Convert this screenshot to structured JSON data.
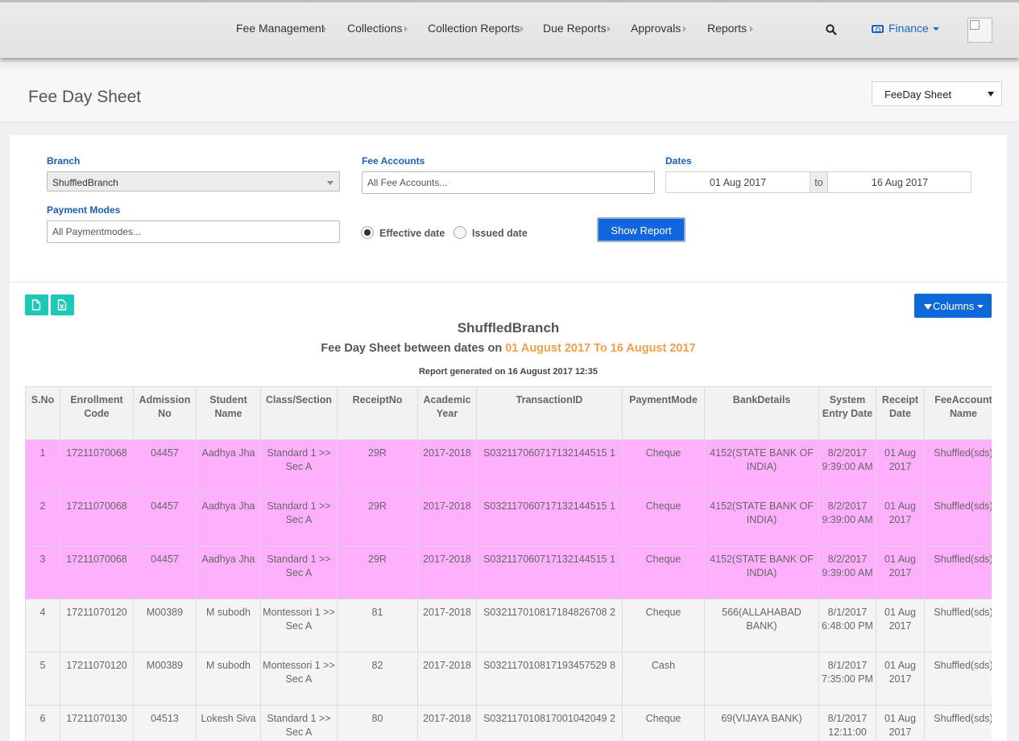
{
  "nav": {
    "items": [
      "Fee Management",
      "Collections",
      "Collection Reports",
      "Due Reports",
      "Approvals",
      "Reports"
    ],
    "finance_label": "Finance"
  },
  "page": {
    "title": "Fee Day Sheet",
    "select_value": "FeeDay Sheet"
  },
  "filters": {
    "branch_label": "Branch",
    "branch_value": "ShuffledBranch",
    "fee_accounts_label": "Fee Accounts",
    "fee_accounts_placeholder": "All Fee Accounts...",
    "dates_label": "Dates",
    "date_from": "01 Aug 2017",
    "date_sep": "to",
    "date_to": "16 Aug 2017",
    "payment_modes_label": "Payment Modes",
    "payment_modes_placeholder": "All Paymentmodes...",
    "radio_effective": "Effective date",
    "radio_issued": "Issued date",
    "show_report": "Show Report"
  },
  "toolbar": {
    "columns_label": "Columns"
  },
  "report": {
    "branch_title": "ShuffledBranch",
    "subtitle_prefix": "Fee Day Sheet between dates on",
    "subtitle_range": "01 August 2017 To 16 August 2017",
    "generated": "Report generated on 16 August 2017 12:35"
  },
  "table": {
    "headers": [
      "S.No",
      "Enrollment Code",
      "Admission No",
      "Student Name",
      "Class/Section",
      "ReceiptNo",
      "Academic Year",
      "TransactionID",
      "PaymentMode",
      "BankDetails",
      "System Entry Date",
      "Receipt Date",
      "FeeAccount Name"
    ],
    "rows": [
      {
        "highlight": true,
        "cells": [
          "1",
          "17211070068",
          "04457",
          "Aadhya Jha",
          "Standard 1 >> Sec A",
          "29R",
          "2017-2018",
          "S032117060717132144515 1",
          "Cheque",
          "4152(STATE BANK OF INDIA)",
          "8/2/2017 9:39:00 AM",
          "01 Aug 2017",
          "Shuffled(sds)"
        ]
      },
      {
        "highlight": true,
        "cells": [
          "2",
          "17211070068",
          "04457",
          "Aadhya Jha",
          "Standard 1 >> Sec A",
          "29R",
          "2017-2018",
          "S032117060717132144515 1",
          "Cheque",
          "4152(STATE BANK OF INDIA)",
          "8/2/2017 9:39:00 AM",
          "01 Aug 2017",
          "Shuffled(sds)"
        ]
      },
      {
        "highlight": true,
        "cells": [
          "3",
          "17211070068",
          "04457",
          "Aadhya Jha",
          "Standard 1 >> Sec A",
          "29R",
          "2017-2018",
          "S032117060717132144515 1",
          "Cheque",
          "4152(STATE BANK OF INDIA)",
          "8/2/2017 9:39:00 AM",
          "01 Aug 2017",
          "Shuffled(sds)"
        ]
      },
      {
        "highlight": false,
        "cells": [
          "4",
          "17211070120",
          "M00389",
          "M subodh",
          "Montessori 1 >> Sec A",
          "81",
          "2017-2018",
          "S032117010817184826708 2",
          "Cheque",
          "566(ALLAHABAD BANK)",
          "8/1/2017 6:48:00 PM",
          "01 Aug 2017",
          "Shuffled(sds)"
        ]
      },
      {
        "highlight": false,
        "cells": [
          "5",
          "17211070120",
          "M00389",
          "M subodh",
          "Montessori 1 >> Sec A",
          "82",
          "2017-2018",
          "S032117010817193457529 8",
          "Cash",
          "",
          "8/1/2017 7:35:00 PM",
          "01 Aug 2017",
          "Shuffled(sds)"
        ]
      },
      {
        "highlight": false,
        "cells": [
          "6",
          "17211070130",
          "04513",
          "Lokesh Siva",
          "Standard 1 >> Sec A",
          "80",
          "2017-2018",
          "S032117010817001042049 2",
          "Cheque",
          "69(VIJAYA BANK)",
          "8/1/2017 12:11:00",
          "01 Aug 2017",
          "Shuffled(sds)"
        ]
      }
    ]
  },
  "colors": {
    "accent_blue": "#1166e0",
    "teal": "#1ec8b6",
    "highlight_row": "#ffb0fd",
    "date_orange": "#f0a049"
  }
}
